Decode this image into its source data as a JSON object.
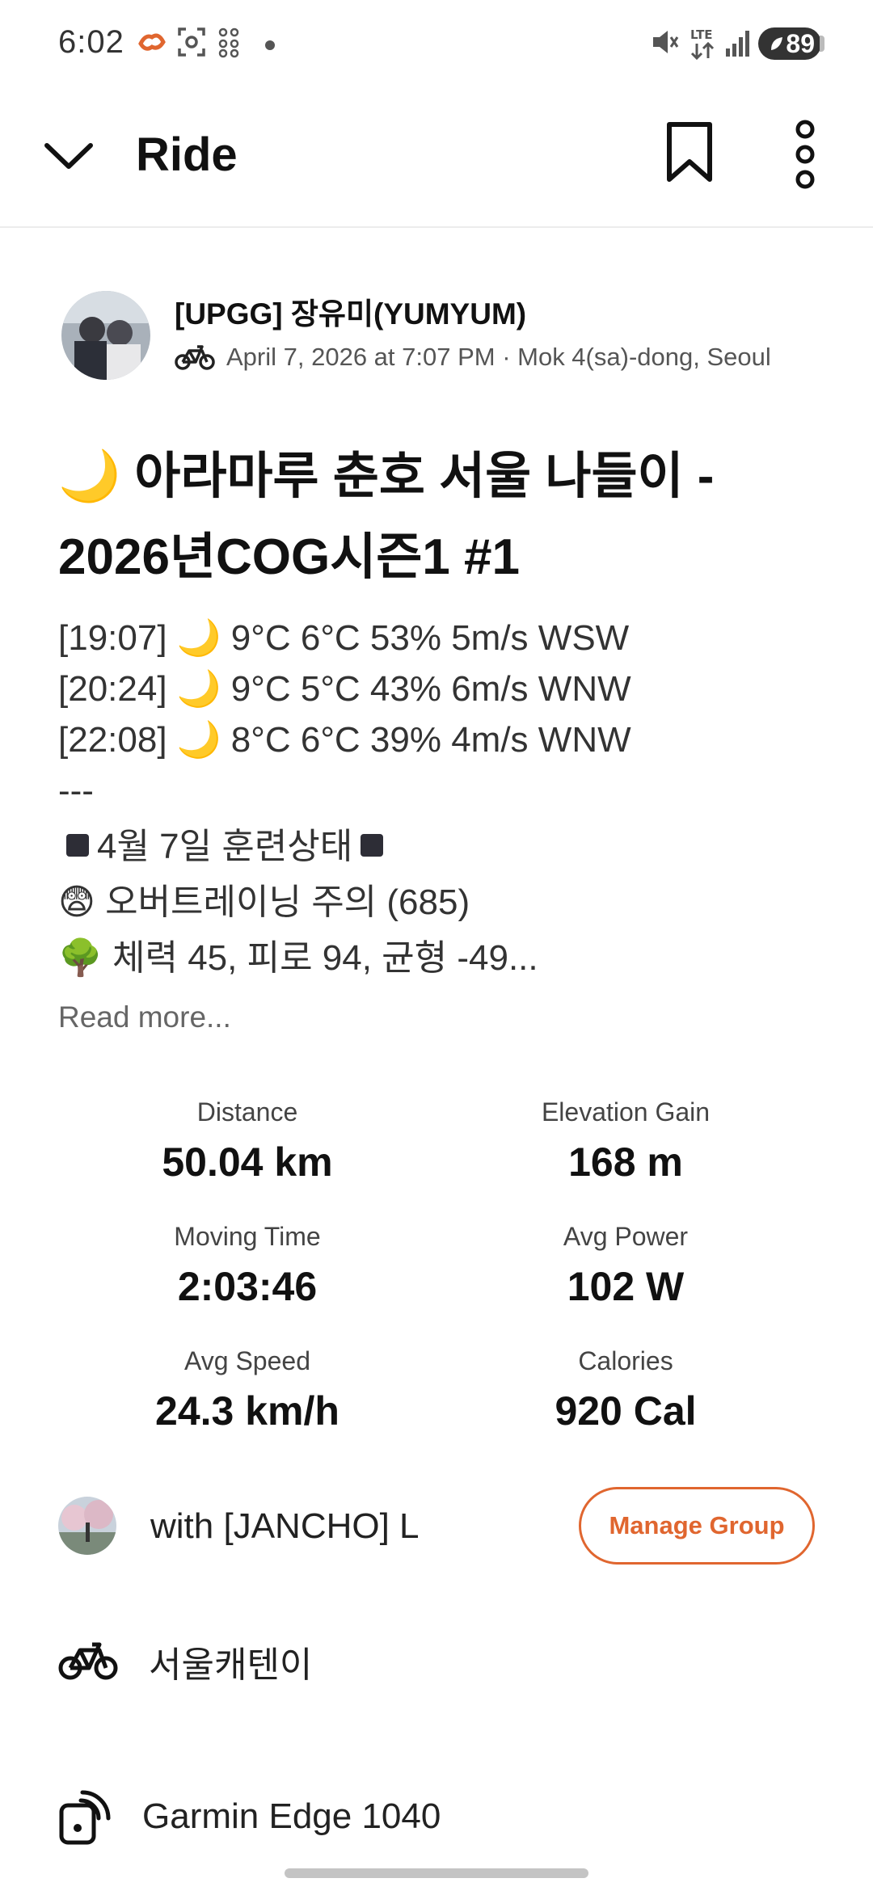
{
  "status_bar": {
    "time": "6:02",
    "battery": "89",
    "icons": [
      "strava-notification-icon",
      "screenshot-icon",
      "app-grid-icon",
      "dot-icon",
      "mute-icon",
      "lte-icon",
      "signal-icon",
      "battery-icon"
    ]
  },
  "header": {
    "title": "Ride",
    "icons": [
      "chevron-down-icon",
      "bookmark-icon",
      "more-vertical-icon"
    ]
  },
  "athlete": {
    "name": "[UPGG] 장유미(YUMYUM)",
    "meta": "April 7, 2026 at 7:07 PM · Mok 4(sa)-dong, Seoul"
  },
  "activity": {
    "title_line1": "🌙 아라마루 춘호 서울 나들이 -",
    "title_line2": "2026년COG시즌1 #1",
    "description": {
      "weather1": "[19:07] 🌙 9°C 6°C 53% 5m/s  WSW",
      "weather2": "[20:24] 🌙 9°C 5°C 43% 6m/s  WNW",
      "weather3": "[22:08] 🌙 8°C 6°C 39% 4m/s  WNW",
      "separator": "---",
      "training_header": "4월 7일 훈련상태",
      "overtraining": "😨 오버트레이닝 주의 (685)",
      "fitness": "🌳 체력 45, 피로 94, 균형 -49..."
    },
    "read_more": "Read more..."
  },
  "stats": {
    "distance": {
      "label": "Distance",
      "value": "50.04 km"
    },
    "elevation": {
      "label": "Elevation Gain",
      "value": "168 m"
    },
    "moving_time": {
      "label": "Moving Time",
      "value": "2:03:46"
    },
    "avg_power": {
      "label": "Avg Power",
      "value": "102 W"
    },
    "avg_speed": {
      "label": "Avg Speed",
      "value": "24.3 km/h"
    },
    "calories": {
      "label": "Calories",
      "value": "920 Cal"
    }
  },
  "group": {
    "with_text": "with [JANCHO] L",
    "manage_button": "Manage Group"
  },
  "gear": {
    "bike": "서울캐텐이",
    "device": "Garmin Edge 1040"
  },
  "colors": {
    "accent": "#e0662f",
    "text": "#111111",
    "muted": "#666666"
  }
}
